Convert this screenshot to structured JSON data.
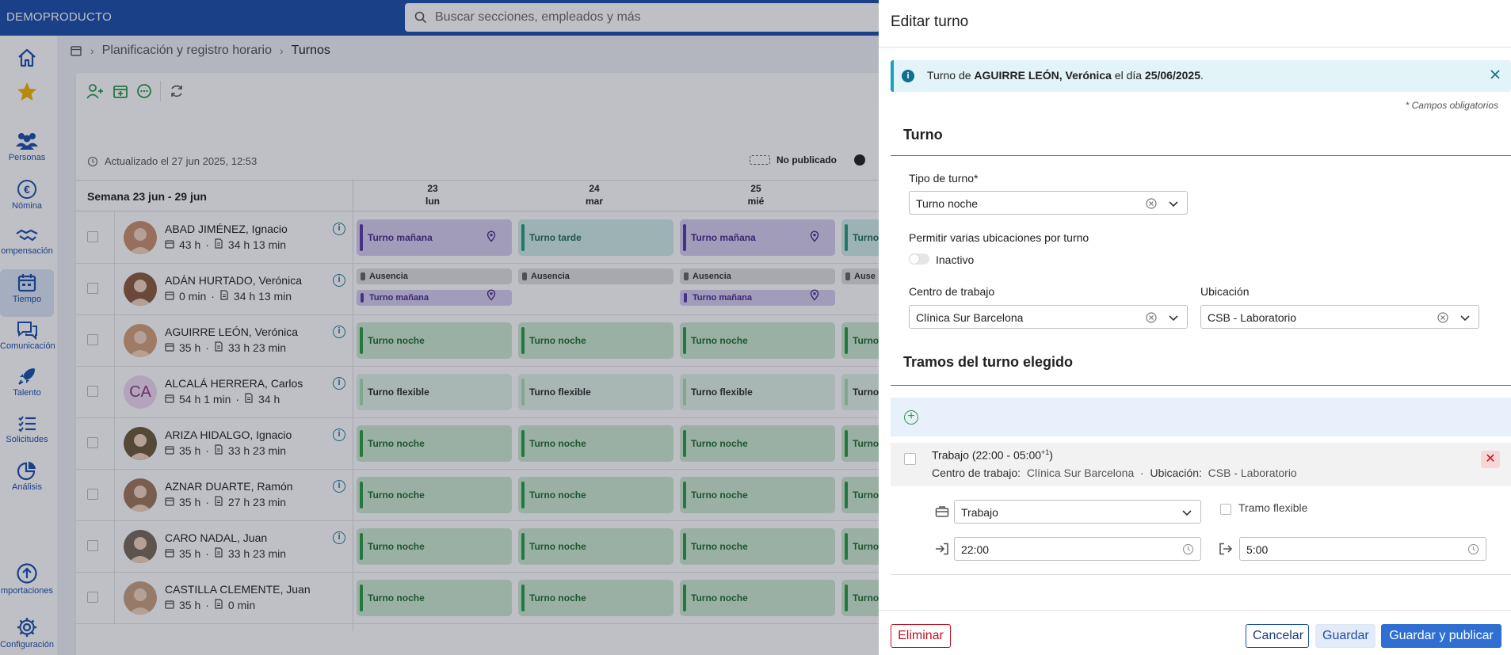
{
  "app": {
    "brand": "DEMOPRODUCTO",
    "search_placeholder": "Buscar secciones, empleados y más"
  },
  "sidebar": {
    "items": [
      {
        "label": "",
        "icon": "home-icon"
      },
      {
        "label": "",
        "icon": "star-icon"
      },
      {
        "label": "Personas",
        "icon": "people-icon"
      },
      {
        "label": "Nómina",
        "icon": "euro-icon"
      },
      {
        "label": "ompensación",
        "icon": "handshake-icon"
      },
      {
        "label": "Tiempo",
        "icon": "calendar-icon",
        "active": true
      },
      {
        "label": "Comunicación",
        "icon": "chat-icon"
      },
      {
        "label": "Talento",
        "icon": "rocket-icon"
      },
      {
        "label": "Solicitudes",
        "icon": "list-icon"
      },
      {
        "label": "Análisis",
        "icon": "pie-icon"
      },
      {
        "label": "mportaciones",
        "icon": "upload-icon"
      },
      {
        "label": "Configuración",
        "icon": "gear-icon"
      }
    ]
  },
  "breadcrumb": {
    "parent": "Planificación y registro horario",
    "current": "Turnos"
  },
  "schedule": {
    "updated": "Actualizado el 27 jun 2025, 12:53",
    "legend_unpublished": "No publicado",
    "week": "Semana 23 jun - 29 jun",
    "days": [
      {
        "num": "23",
        "name": "lun"
      },
      {
        "num": "24",
        "name": "mar"
      },
      {
        "num": "25",
        "name": "mié"
      }
    ],
    "employees": [
      {
        "name": "ABAD JIMÉNEZ, Ignacio",
        "hours": "43 h",
        "worked": "34 h 13 min"
      },
      {
        "name": "ADÁN HURTADO, Verónica",
        "hours": "0 min",
        "worked": "34 h 13 min"
      },
      {
        "name": "AGUIRRE LEÓN, Verónica",
        "hours": "35 h",
        "worked": "33 h 23 min"
      },
      {
        "name": "ALCALÁ HERRERA, Carlos",
        "hours": "54 h 1 min",
        "worked": "34 h",
        "initials": "CA"
      },
      {
        "name": "ARIZA HIDALGO, Ignacio",
        "hours": "35 h",
        "worked": "33 h 23 min"
      },
      {
        "name": "AZNAR DUARTE, Ramón",
        "hours": "35 h",
        "worked": "27 h 23 min"
      },
      {
        "name": "CARO NADAL, Juan",
        "hours": "35 h",
        "worked": "33 h 23 min"
      },
      {
        "name": "CASTILLA CLEMENTE, Juan",
        "hours": "35 h",
        "worked": "0 min"
      }
    ],
    "labels": {
      "morning": "Turno mañana",
      "afternoon": "Turno tarde",
      "night": "Turno noche",
      "flex": "Turno flexible",
      "absence": "Ausencia",
      "night_cut": "Turno",
      "flex_cut": "Turno",
      "absence_cut": "Ause"
    }
  },
  "panel": {
    "title": "Editar turno",
    "alert_prefix": "Turno de ",
    "alert_name": "AGUIRRE LEÓN, Verónica",
    "alert_mid": " el día ",
    "alert_date": "25/06/2025",
    "alert_end": ".",
    "required_note": "* Campos obligatorios",
    "section_shift": "Turno",
    "shift_type_label": "Tipo de turno*",
    "shift_type_value": "Turno noche",
    "multi_loc_label": "Permitir varias ubicaciones por turno",
    "multi_loc_state": "Inactivo",
    "center_label": "Centro de trabajo",
    "center_value": "Clínica Sur Barcelona",
    "location_label": "Ubicación",
    "location_value": "CSB - Laboratorio",
    "section_segments": "Tramos del turno elegido",
    "segment": {
      "title": "Trabajo (22:00 - 05:00",
      "sup": "+1",
      "title_end": ")",
      "center_lbl": "Centro de trabajo:",
      "center_val": "Clínica Sur Barcelona",
      "sep": "·",
      "loc_lbl": "Ubicación:",
      "loc_val": "CSB - Laboratorio"
    },
    "segment_type": "Trabajo",
    "flexible_label": "Tramo flexible",
    "start_time": "22:00",
    "end_time": "5:00",
    "buttons": {
      "delete": "Eliminar",
      "cancel": "Cancelar",
      "save": "Guardar",
      "save_publish": "Guardar y publicar"
    }
  },
  "colors": {
    "brand": "#1d4ea8",
    "night": "#2c9a46",
    "morning": "#5b3aa8",
    "danger": "#c1121f"
  }
}
